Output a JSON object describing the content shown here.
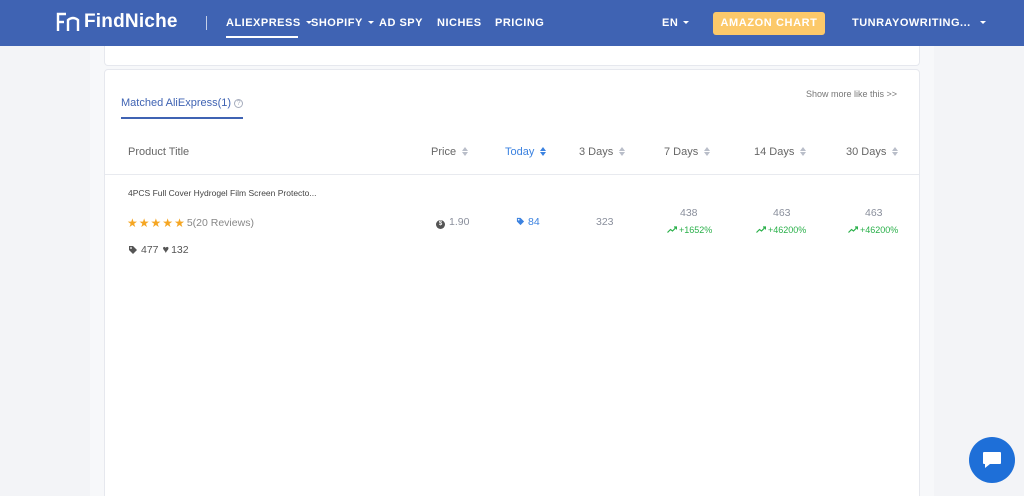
{
  "nav": {
    "brand": "FindNiche",
    "items": [
      {
        "label": "ALIEXPRESS"
      },
      {
        "label": "SHOPIFY"
      },
      {
        "label": "AD SPY"
      },
      {
        "label": "NICHES"
      },
      {
        "label": "PRICING"
      }
    ],
    "lang": "EN",
    "amazon_button": "AMAZON CHART",
    "user": "TUNRAYOWRITING..."
  },
  "card": {
    "tab": "Matched AliExpress(1)",
    "show_more": "Show more like this >>",
    "columns": [
      "Product Title",
      "Price",
      "Today",
      "3 Days",
      "7 Days",
      "14 Days",
      "30 Days"
    ],
    "row": {
      "title": "4PCS Full Cover Hydrogel Film Screen Protecto...",
      "rating": "5",
      "reviews": "(20 Reviews)",
      "tags_count": "477",
      "likes_count": "132",
      "price": "1.90",
      "today": "84",
      "days3": "323",
      "days7": "438",
      "days7_growth": "+1652%",
      "days14": "463",
      "days14_growth": "+46200%",
      "days30": "463",
      "days30_growth": "+46200%"
    }
  },
  "colors": {
    "navbar": "#3f63b3",
    "amazon_button": "#fcc96a",
    "active": "#3b82e0",
    "growth": "#2ab04a",
    "star": "#f5a623",
    "chat": "#1e6fd8"
  },
  "icons": [
    "findniche-logo-icon",
    "help-icon",
    "star-icon",
    "tag-icon",
    "heart-icon",
    "dollar-icon",
    "trend-up-icon",
    "chat-icon"
  ]
}
